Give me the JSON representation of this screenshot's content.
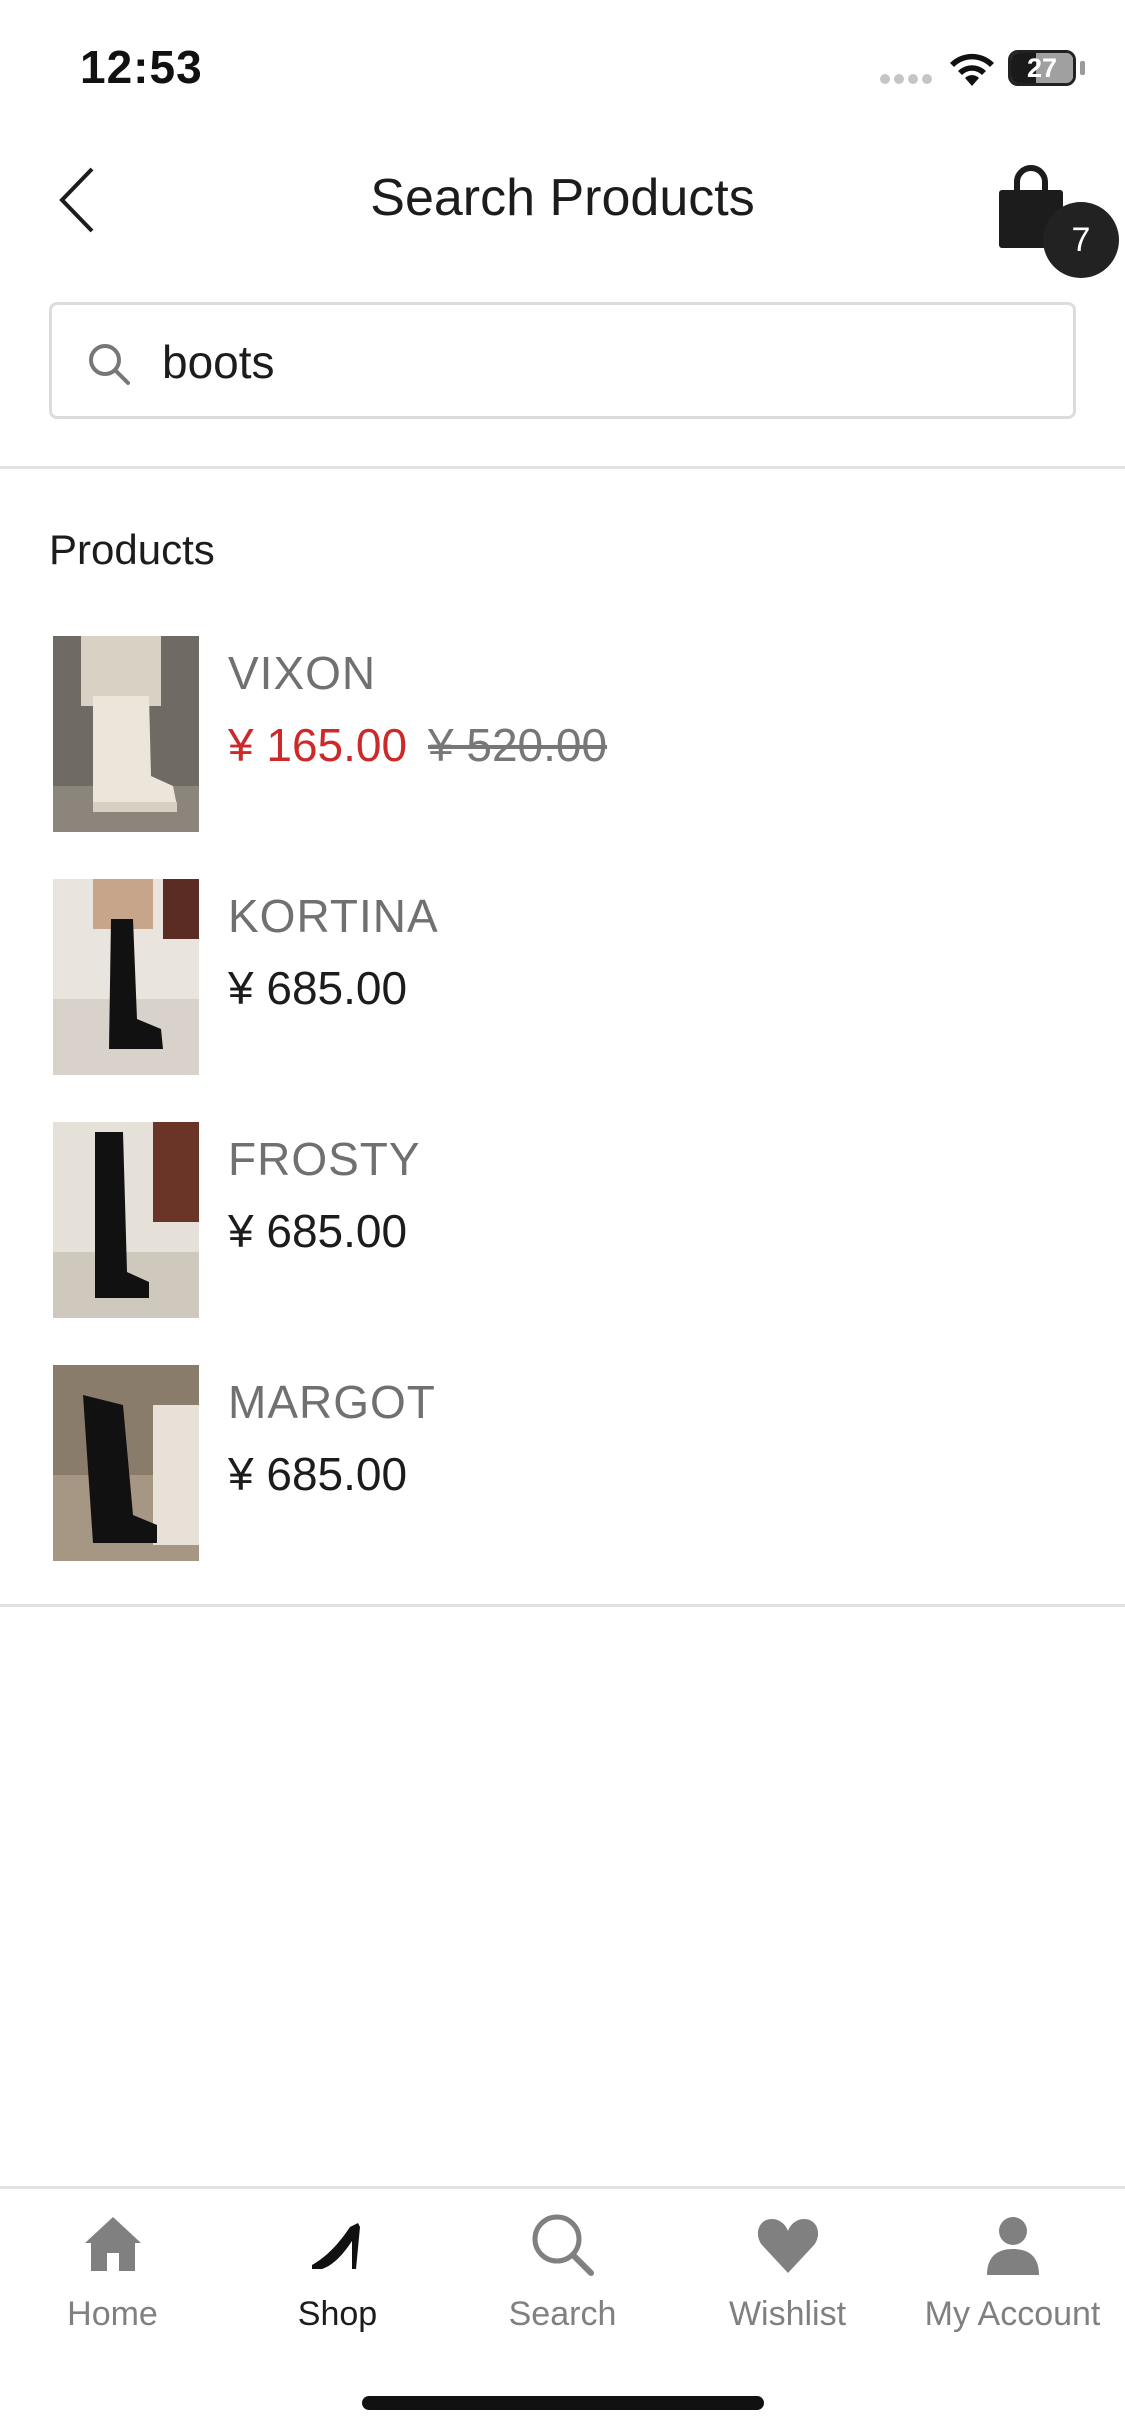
{
  "status_bar": {
    "time": "12:53",
    "battery": "27"
  },
  "header": {
    "title": "Search Products",
    "back_icon": "chevron-left-icon",
    "cart_icon": "shopping-bag-icon",
    "cart_count": "7"
  },
  "search": {
    "value": "boots",
    "placeholder": "",
    "icon": "search-icon"
  },
  "products_section": {
    "title": "Products",
    "items": [
      {
        "name": "VIXON",
        "price": "¥ 165.00",
        "old_price": "¥ 520.00",
        "on_sale": true,
        "image": "cream ankle boot"
      },
      {
        "name": "KORTINA",
        "price": "¥ 685.00",
        "old_price": "",
        "on_sale": false,
        "image": "black knee boot"
      },
      {
        "name": "FROSTY",
        "price": "¥ 685.00",
        "old_price": "",
        "on_sale": false,
        "image": "black knee boot"
      },
      {
        "name": "MARGOT",
        "price": "¥ 685.00",
        "old_price": "",
        "on_sale": false,
        "image": "black knee boot"
      }
    ]
  },
  "tab_bar": {
    "items": [
      {
        "label": "Home",
        "icon": "home-icon",
        "active": false
      },
      {
        "label": "Shop",
        "icon": "high-heel-icon",
        "active": true
      },
      {
        "label": "Search",
        "icon": "search-icon",
        "active": false
      },
      {
        "label": "Wishlist",
        "icon": "heart-icon",
        "active": false
      },
      {
        "label": "My Account",
        "icon": "person-icon",
        "active": false
      }
    ]
  },
  "colors": {
    "sale_price": "#cc2a2a",
    "text_primary": "#1c1c1c",
    "text_secondary": "#707070",
    "inactive_tab": "#808080",
    "badge": "#222222"
  }
}
